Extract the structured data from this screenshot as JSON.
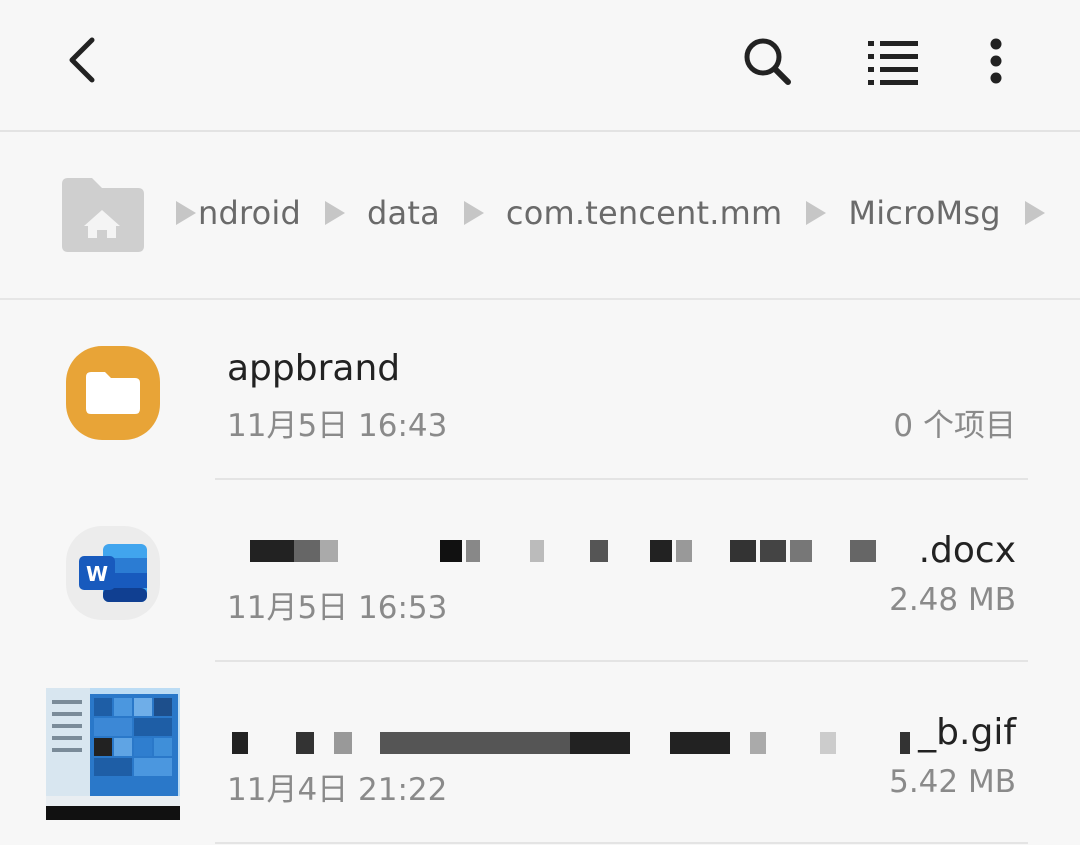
{
  "toolbar": {
    "back_icon": "back-chevron-icon",
    "search_icon": "search-icon",
    "list_view_icon": "list-view-icon",
    "more_icon": "more-vertical-icon"
  },
  "breadcrumb": {
    "home_icon": "home-folder-icon",
    "items": [
      "ndroid",
      "data",
      "com.tencent.mm",
      "MicroMsg"
    ]
  },
  "files": [
    {
      "type": "folder",
      "icon": "folder-icon",
      "icon_color": "#e8a437",
      "name": "appbrand",
      "date": "11月5日 16:43",
      "meta": "0 个项目"
    },
    {
      "type": "docx",
      "icon": "word-icon",
      "icon_color": "#185abd",
      "name": ".docx",
      "date": "11月5日 16:53",
      "meta": "2.48 MB"
    },
    {
      "type": "gif",
      "icon": "image-thumbnail",
      "name": "_b.gif",
      "date": "11月4日 21:22",
      "meta": "5.42 MB"
    }
  ]
}
